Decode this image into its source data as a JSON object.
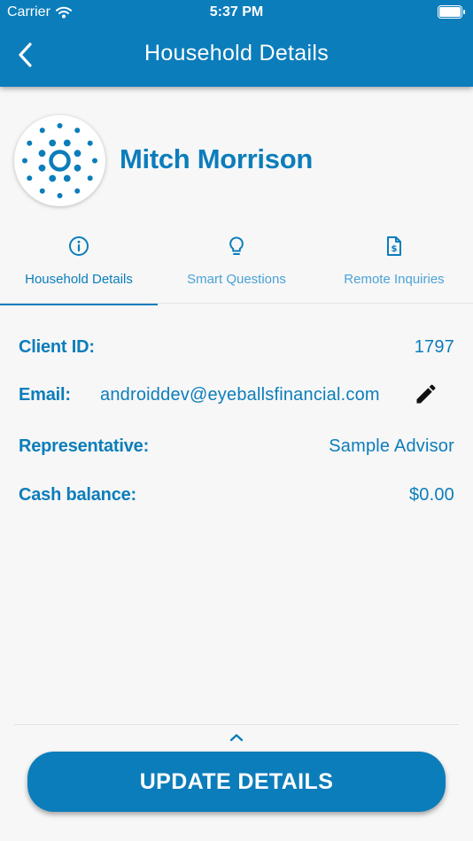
{
  "status_bar": {
    "carrier": "Carrier",
    "time": "5:37 PM",
    "wifi_icon": "wifi-icon",
    "battery_icon": "battery-icon"
  },
  "header": {
    "title": "Household Details",
    "back_icon": "chevron-left-icon",
    "background": "#0c7dbb"
  },
  "profile": {
    "name": "Mitch Morrison",
    "avatar_icon": "radial-dots-logo"
  },
  "tabs": [
    {
      "label": "Household Details",
      "icon": "info-circle-icon",
      "active": true
    },
    {
      "label": "Smart Questions",
      "icon": "lightbulb-icon",
      "active": false
    },
    {
      "label": "Remote Inquiries",
      "icon": "dollar-document-icon",
      "active": false
    }
  ],
  "details": {
    "client_id": {
      "label": "Client ID:",
      "value": "1797"
    },
    "email": {
      "label": "Email:",
      "value": "androiddev@eyeballsfinancial.com",
      "edit_icon": "pencil-icon"
    },
    "representative": {
      "label": "Representative:",
      "value": "Sample Advisor"
    },
    "cash_balance": {
      "label": "Cash balance:",
      "value": "$0.00"
    }
  },
  "footer": {
    "expand_icon": "chevron-up-icon",
    "update_button": "UPDATE DETAILS"
  },
  "colors": {
    "accent": "#0c7dbb",
    "accent_light": "#4aa2d6",
    "background": "#f7f7f7"
  }
}
